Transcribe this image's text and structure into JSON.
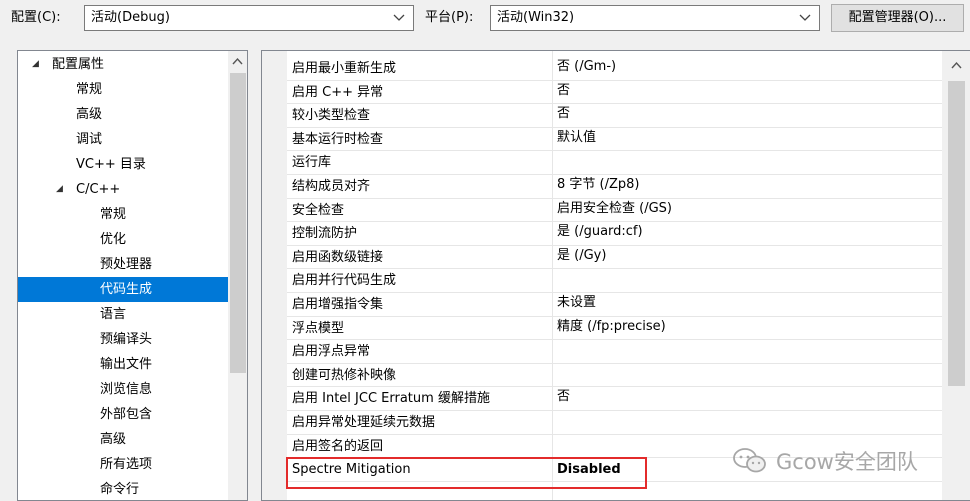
{
  "toolbar": {
    "config_label": "配置(C):",
    "config_value": "活动(Debug)",
    "platform_label": "平台(P):",
    "platform_value": "活动(Win32)",
    "config_manager_button": "配置管理器(O)..."
  },
  "tree": {
    "items": [
      {
        "label": "配置属性",
        "level": 0,
        "expanded": true
      },
      {
        "label": "常规",
        "level": 1
      },
      {
        "label": "高级",
        "level": 1
      },
      {
        "label": "调试",
        "level": 1
      },
      {
        "label": "VC++ 目录",
        "level": 1
      },
      {
        "label": "C/C++",
        "level": 1,
        "expanded": true
      },
      {
        "label": "常规",
        "level": 2
      },
      {
        "label": "优化",
        "level": 2
      },
      {
        "label": "预处理器",
        "level": 2
      },
      {
        "label": "代码生成",
        "level": 2,
        "selected": true
      },
      {
        "label": "语言",
        "level": 2
      },
      {
        "label": "预编译头",
        "level": 2
      },
      {
        "label": "输出文件",
        "level": 2
      },
      {
        "label": "浏览信息",
        "level": 2
      },
      {
        "label": "外部包含",
        "level": 2
      },
      {
        "label": "高级",
        "level": 2
      },
      {
        "label": "所有选项",
        "level": 2
      },
      {
        "label": "命令行",
        "level": 2
      }
    ]
  },
  "properties": {
    "rows": [
      {
        "name": "启用最小重新生成",
        "value": "否 (/Gm-)"
      },
      {
        "name": "启用 C++ 异常",
        "value": "否"
      },
      {
        "name": "较小类型检查",
        "value": "否"
      },
      {
        "name": "基本运行时检查",
        "value": "默认值"
      },
      {
        "name": "运行库",
        "value": ""
      },
      {
        "name": "结构成员对齐",
        "value": "8 字节 (/Zp8)"
      },
      {
        "name": "安全检查",
        "value": "启用安全检查 (/GS)"
      },
      {
        "name": "控制流防护",
        "value": "是 (/guard:cf)"
      },
      {
        "name": "启用函数级链接",
        "value": "是 (/Gy)"
      },
      {
        "name": "启用并行代码生成",
        "value": ""
      },
      {
        "name": "启用增强指令集",
        "value": "未设置"
      },
      {
        "name": "浮点模型",
        "value": "精度 (/fp:precise)"
      },
      {
        "name": "启用浮点异常",
        "value": ""
      },
      {
        "name": "创建可热修补映像",
        "value": ""
      },
      {
        "name": "启用 Intel JCC Erratum 缓解措施",
        "value": "否"
      },
      {
        "name": "启用异常处理延续元数据",
        "value": ""
      },
      {
        "name": "启用签名的返回",
        "value": ""
      },
      {
        "name": "Spectre Mitigation",
        "value": "Disabled",
        "highlighted": true
      }
    ]
  },
  "watermark": {
    "text": "Gcow安全团队",
    "icon": "wechat-icon"
  },
  "colors": {
    "selection": "#0078d7",
    "highlight_border": "#e32b2b"
  }
}
